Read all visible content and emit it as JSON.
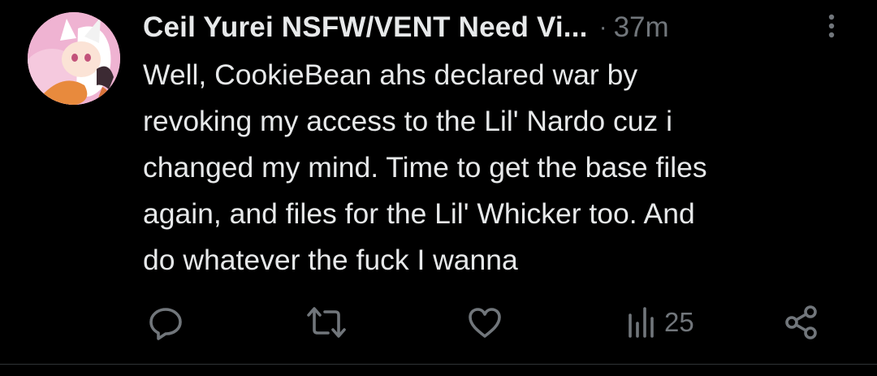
{
  "tweet": {
    "display_name": "Ceil Yurei NSFW/VENT Need Vi...",
    "separator": "·",
    "timestamp": "37m",
    "text": "Well, CookieBean ahs declared war by\nrevoking my access to the Lil' Nardo cuz i\nchanged my mind. Time to get the base files\nagain, and files for the Lil' Whicker too. And\ndo whatever the fuck I wanna"
  },
  "actions": {
    "reply_icon": "reply-icon",
    "retweet_icon": "retweet-icon",
    "like_icon": "heart-icon",
    "views_icon": "views-icon",
    "views_count": "25",
    "share_icon": "share-icon"
  },
  "colors": {
    "background": "#000000",
    "primary_text": "#e7e9ea",
    "secondary_text": "#71767b",
    "divider": "#2f3336"
  }
}
